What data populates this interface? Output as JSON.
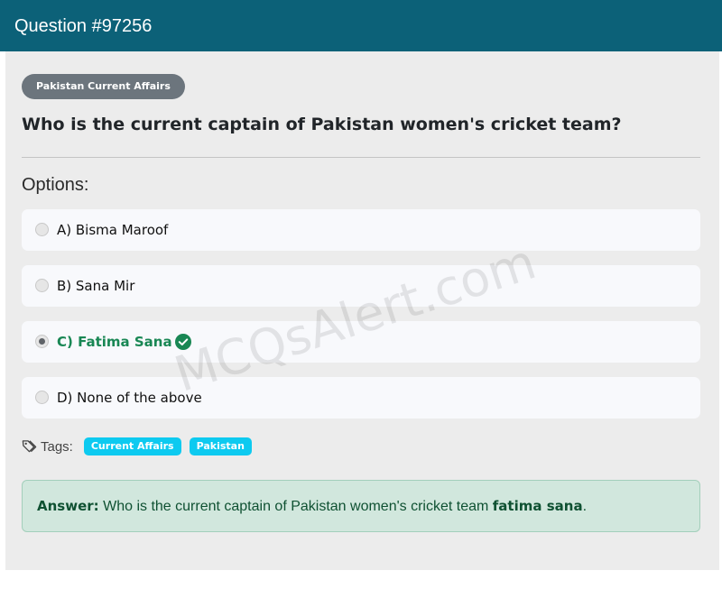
{
  "header": {
    "title": "Question #97256"
  },
  "question": {
    "category": "Pakistan Current Affairs",
    "text": "Who is the current captain of Pakistan women's cricket team?"
  },
  "options_label": "Options:",
  "options": [
    {
      "label": "A) Bisma Maroof",
      "selected": false,
      "correct": false
    },
    {
      "label": "B) Sana Mir",
      "selected": false,
      "correct": false
    },
    {
      "label": "C) Fatima Sana",
      "selected": true,
      "correct": true
    },
    {
      "label": "D) None of the above",
      "selected": false,
      "correct": false
    }
  ],
  "watermark": "MCQsAlert.com",
  "tags": {
    "label": "Tags:",
    "items": [
      "Current Affairs",
      "Pakistan"
    ]
  },
  "answer": {
    "label": "Answer:",
    "text": " Who is the current captain of Pakistan women's cricket team ",
    "bold": "fatima sana",
    "end": "."
  },
  "colors": {
    "header_bg": "#0c6178",
    "correct": "#198754",
    "tag_bg": "#0dcaf0",
    "answer_bg": "#d1e7dd"
  },
  "icons": [
    "tags-icon",
    "check-circle-icon",
    "radio-icon"
  ]
}
